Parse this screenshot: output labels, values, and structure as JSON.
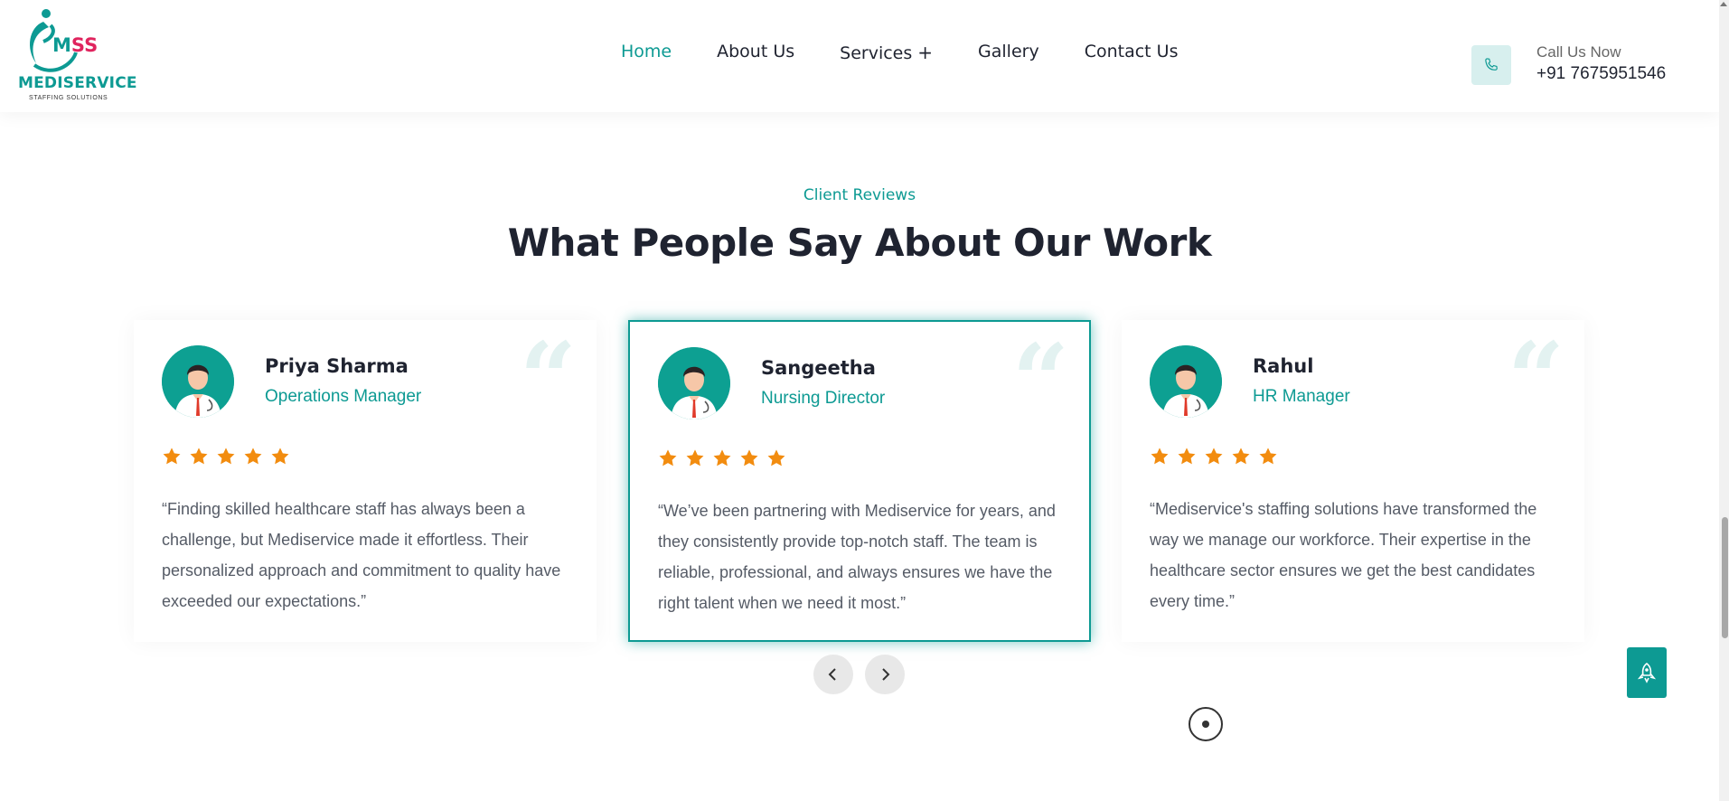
{
  "brand": {
    "mark": "MSS",
    "mark_m": "M",
    "mark_ss": "SS",
    "name": "MEDISERVICE",
    "tagline": "STAFFING SOLUTIONS"
  },
  "nav": {
    "items": [
      {
        "label": "Home",
        "active": true
      },
      {
        "label": "About Us"
      },
      {
        "label": "Services"
      },
      {
        "label": "Gallery"
      },
      {
        "label": "Contact Us"
      }
    ],
    "services_plus": "+"
  },
  "call": {
    "label": "Call Us Now",
    "number": "+91 7675951546"
  },
  "section": {
    "eyebrow": "Client Reviews",
    "title": "What People Say About Our Work"
  },
  "reviews": [
    {
      "name": "Priya Sharma",
      "role": "Operations Manager",
      "rating": 5,
      "text": "“Finding skilled healthcare staff has always been a challenge, but Mediservice made it effortless. Their personalized approach and commitment to quality have exceeded our expectations.”"
    },
    {
      "name": "Sangeetha",
      "role": "Nursing Director",
      "rating": 5,
      "text": "“We’ve been partnering with Mediservice for years, and they consistently provide top-notch staff. The team is reliable, professional, and always ensures we have the right talent when we need it most.”",
      "active": true
    },
    {
      "name": "Rahul",
      "role": "HR Manager",
      "rating": 5,
      "text": "“Mediservice's staffing solutions have transformed the way we manage our workforce. Their expertise in the healthcare sector ensures we get the best candidates every time.”"
    }
  ],
  "quote_glyph": "“",
  "colors": {
    "accent": "#0d9a93",
    "star": "#f28c0f",
    "heading": "#1f2330",
    "body": "#555b66"
  },
  "icons": {
    "phone": "phone-icon",
    "prev": "chevron-left-icon",
    "next": "chevron-right-icon",
    "rocket": "rocket-icon",
    "quote": "quote-icon",
    "star": "star-icon"
  }
}
